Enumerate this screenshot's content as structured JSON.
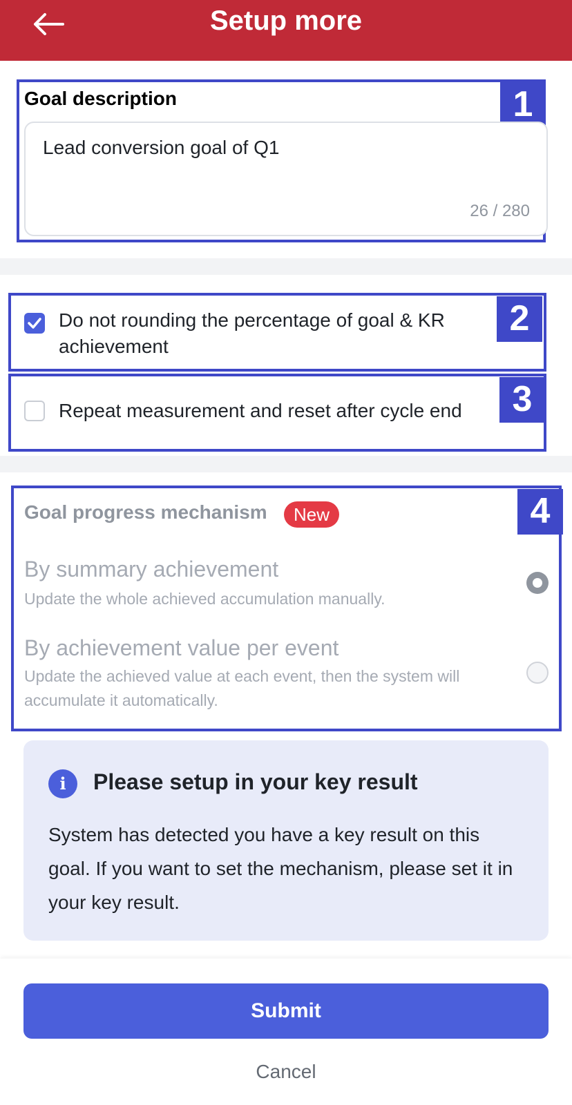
{
  "header": {
    "title": "Setup more",
    "back_icon": "arrow-left-icon"
  },
  "goal_description": {
    "label": "Goal description",
    "value": "Lead conversion goal of Q1",
    "counter": "26 / 280"
  },
  "options": {
    "no_rounding": {
      "label": "Do not rounding the percentage of goal & KR achievement",
      "checked": true
    },
    "repeat_measurement": {
      "label": "Repeat measurement and reset after cycle end",
      "checked": false
    }
  },
  "mechanism": {
    "title": "Goal progress mechanism",
    "badge": "New",
    "choices": [
      {
        "title": "By summary achievement",
        "desc": "Update the whole achieved accumulation manually.",
        "selected": true
      },
      {
        "title": "By achievement value per event",
        "desc": "Update the achieved value at each event, then the system will accumulate it automatically.",
        "selected": false
      }
    ]
  },
  "info": {
    "icon": "i",
    "title": "Please setup in your key result",
    "body": "System has detected you have a key result on this goal. If you want to set the mechanism, please set it in your key result."
  },
  "annotations": [
    "1",
    "2",
    "3",
    "4"
  ],
  "footer": {
    "submit": "Submit",
    "cancel": "Cancel"
  },
  "colors": {
    "header": "#c02a37",
    "accent": "#4b5fdb",
    "annotation": "#3f48c8",
    "badge": "#e43a45"
  }
}
